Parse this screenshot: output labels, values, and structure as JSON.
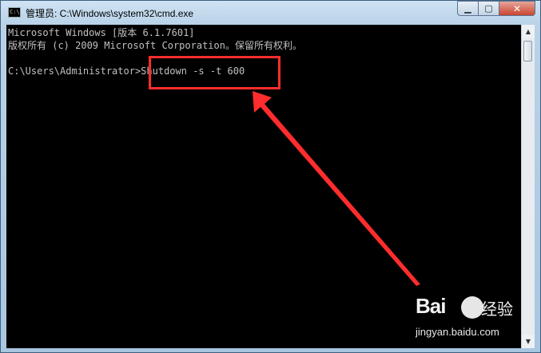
{
  "window": {
    "title": "管理员: C:\\Windows\\system32\\cmd.exe",
    "icon": "cmd-icon",
    "icon_text": "C:\\",
    "minimize": "▁",
    "maximize": "▢",
    "close": "✕"
  },
  "console": {
    "lines": [
      "Microsoft Windows [版本 6.1.7601]",
      "版权所有 (c) 2009 Microsoft Corporation。保留所有权利。",
      "",
      "C:\\Users\\Administrator>Shutdown -s -t 600"
    ]
  },
  "annotation": {
    "box_color": "#ff2d2d",
    "arrow_color": "#ff2d2d"
  },
  "scrollbar": {
    "up": "▲",
    "down": "▼"
  },
  "watermark": {
    "logo": "Bai",
    "logo_suffix": "经验",
    "url": "jingyan.baidu.com"
  }
}
